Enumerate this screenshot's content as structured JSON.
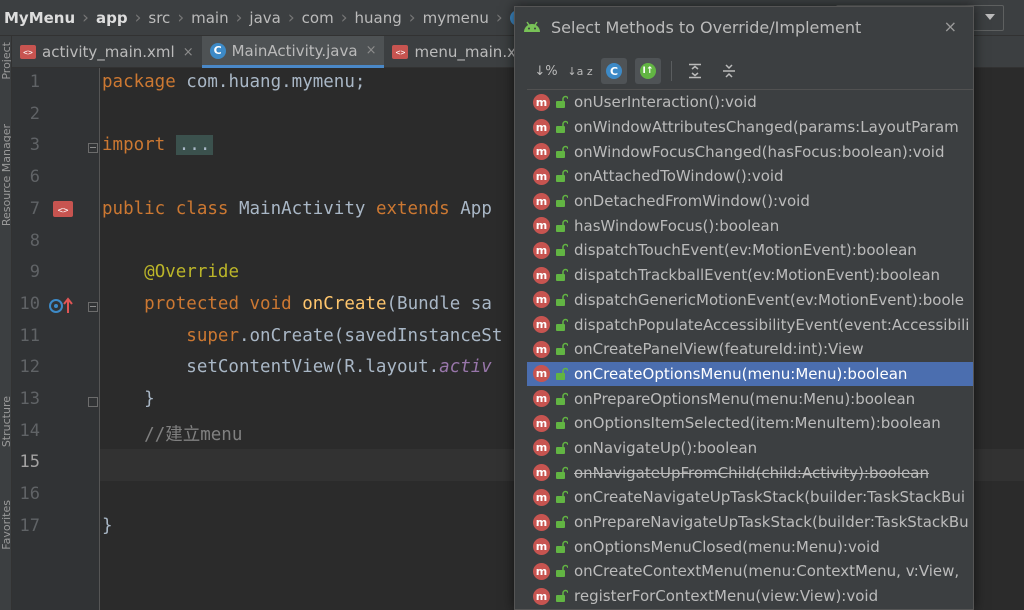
{
  "breadcrumb": [
    {
      "label": "MyMenu",
      "bold": true
    },
    {
      "label": "app",
      "bold": true
    },
    {
      "label": "src"
    },
    {
      "label": "main"
    },
    {
      "label": "java"
    },
    {
      "label": "com"
    },
    {
      "label": "huang"
    },
    {
      "label": "mymenu"
    }
  ],
  "breadcrumb_class_icon": "C",
  "tabs": [
    {
      "label": "activity_main.xml",
      "icon": "xml-icon",
      "close": "×",
      "active": false
    },
    {
      "label": "MainActivity.java",
      "icon": "class-icon",
      "close": "×",
      "active": true
    },
    {
      "label": "menu_main.xml",
      "icon": "xml-icon",
      "close": "",
      "active": false
    }
  ],
  "left_strip": {
    "project": "Project",
    "resource_manager": "Resource Manager",
    "structure": "Structure",
    "favorites": "Favorites"
  },
  "editor": {
    "current_line": 15,
    "lines": [
      {
        "n": "1",
        "html": "<span class=\"kw\">package</span> com.huang.mymenu;"
      },
      {
        "n": "2",
        "html": ""
      },
      {
        "n": "3",
        "html": "<span class=\"kw\">import</span> <span class=\"fold\">...</span>"
      },
      {
        "n": "6",
        "html": ""
      },
      {
        "n": "7",
        "html": "<span class=\"kw\">public class</span> MainActivity <span class=\"kw\">extends</span> App"
      },
      {
        "n": "8",
        "html": ""
      },
      {
        "n": "9",
        "html": "    <span class=\"ann\">@Override</span>"
      },
      {
        "n": "10",
        "html": "    <span class=\"kw\">protected void</span> <span class=\"meth\">onCreate</span>(Bundle sa"
      },
      {
        "n": "11",
        "html": "        <span class=\"kw\">super</span>.onCreate(savedInstanceSt"
      },
      {
        "n": "12",
        "html": "        setContentView(R.layout.<span class=\"ital\">activ</span>"
      },
      {
        "n": "13",
        "html": "    }"
      },
      {
        "n": "14",
        "html": "    <span class=\"cmt\">//建立menu</span>"
      },
      {
        "n": "15",
        "html": ""
      },
      {
        "n": "16",
        "html": ""
      },
      {
        "n": "17",
        "html": "}"
      }
    ]
  },
  "dialog": {
    "title": "Select Methods to Override/Implement",
    "close": "×",
    "toolbar": {
      "sort_by_visibility": "↓%",
      "sort_alpha": "↓a z",
      "class_icon": "C",
      "interface_icon": "I↑"
    },
    "selected_index": 11,
    "methods": [
      {
        "label": "onUserInteraction():void",
        "deprecated": false
      },
      {
        "label": "onWindowAttributesChanged(params:LayoutParam",
        "deprecated": false
      },
      {
        "label": "onWindowFocusChanged(hasFocus:boolean):void",
        "deprecated": false
      },
      {
        "label": "onAttachedToWindow():void",
        "deprecated": false
      },
      {
        "label": "onDetachedFromWindow():void",
        "deprecated": false
      },
      {
        "label": "hasWindowFocus():boolean",
        "deprecated": false
      },
      {
        "label": "dispatchTouchEvent(ev:MotionEvent):boolean",
        "deprecated": false
      },
      {
        "label": "dispatchTrackballEvent(ev:MotionEvent):boolean",
        "deprecated": false
      },
      {
        "label": "dispatchGenericMotionEvent(ev:MotionEvent):boole",
        "deprecated": false
      },
      {
        "label": "dispatchPopulateAccessibilityEvent(event:Accessibili",
        "deprecated": false
      },
      {
        "label": "onCreatePanelView(featureId:int):View",
        "deprecated": false
      },
      {
        "label": "onCreateOptionsMenu(menu:Menu):boolean",
        "deprecated": false
      },
      {
        "label": "onPrepareOptionsMenu(menu:Menu):boolean",
        "deprecated": false
      },
      {
        "label": "onOptionsItemSelected(item:MenuItem):boolean",
        "deprecated": false
      },
      {
        "label": "onNavigateUp():boolean",
        "deprecated": false
      },
      {
        "label": "onNavigateUpFromChild(child:Activity):boolean",
        "deprecated": true
      },
      {
        "label": "onCreateNavigateUpTaskStack(builder:TaskStackBui",
        "deprecated": false
      },
      {
        "label": "onPrepareNavigateUpTaskStack(builder:TaskStackBu",
        "deprecated": false
      },
      {
        "label": "onOptionsMenuClosed(menu:Menu):void",
        "deprecated": false
      },
      {
        "label": "onCreateContextMenu(menu:ContextMenu, v:View, ",
        "deprecated": false
      },
      {
        "label": "registerForContextMenu(view:View):void",
        "deprecated": false
      }
    ],
    "method_icon_letter": "m"
  },
  "colors": {
    "accent": "#4a88c7",
    "selection": "#4b6eaf",
    "method_icon": "#c75450",
    "keyword": "#cc7832"
  }
}
